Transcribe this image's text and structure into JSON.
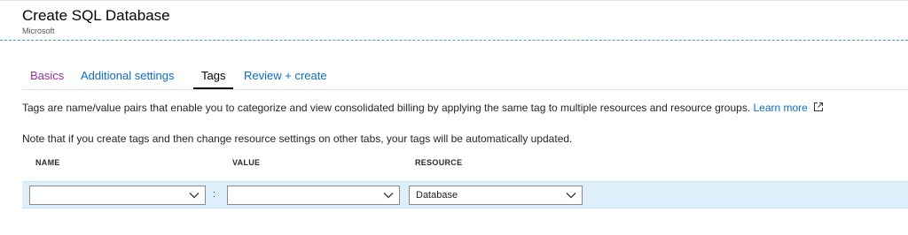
{
  "header": {
    "title": "Create SQL Database",
    "subtitle": "Microsoft"
  },
  "tabs": [
    {
      "label": "Basics",
      "state": "visited"
    },
    {
      "label": "Additional settings",
      "state": "link"
    },
    {
      "label": "Tags",
      "state": "active"
    },
    {
      "label": "Review + create",
      "state": "link"
    }
  ],
  "description": {
    "text": "Tags are name/value pairs that enable you to categorize and view consolidated billing by applying the same tag to multiple resources and resource groups. ",
    "link": "Learn more",
    "link_icon": "external-link-icon"
  },
  "note": "Note that if you create tags and then change resource settings on other tabs, your tags will be automatically updated.",
  "table": {
    "columns": [
      "NAME",
      "VALUE",
      "RESOURCE"
    ],
    "row": {
      "name": "",
      "separator": ":",
      "value": "",
      "resource": "Database"
    }
  },
  "colors": {
    "link": "#0a6cd5",
    "visited": "#9c2fa3",
    "row_highlight": "#ddeffb",
    "dashed_rule": "#3fa0d6"
  }
}
